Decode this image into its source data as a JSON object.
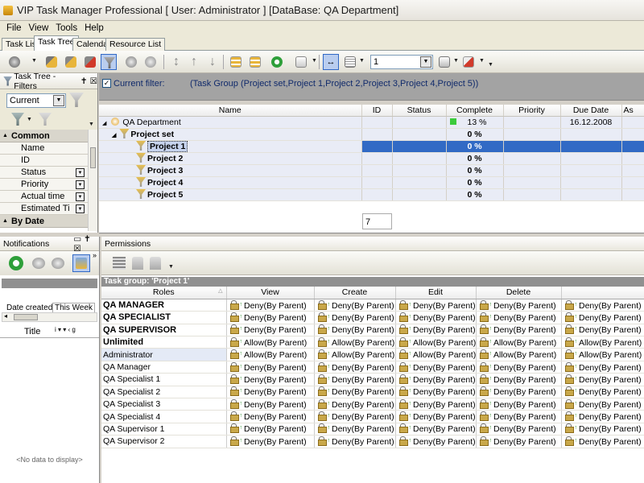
{
  "window": {
    "title": "VIP Task Manager Professional [ User: Administrator ] [DataBase: QA Department]"
  },
  "menu": [
    "File",
    "View",
    "Tools",
    "Help"
  ],
  "tabs": [
    "Task List",
    "Task Tree",
    "Calendar",
    "Resource List"
  ],
  "toolbar": {
    "page_value": "1"
  },
  "filters_panel": {
    "title": "Task Tree - Filters",
    "current": "Current",
    "common_label": "Common",
    "fields": [
      "Name",
      "ID",
      "Status",
      "Priority",
      "Actual time",
      "Estimated Ti"
    ],
    "by_date_label": "By Date"
  },
  "filter_bar": {
    "checkbox_label": "Current filter:",
    "expression": "(Task Group  (Project set,Project 1,Project 2,Project 3,Project 4,Project 5))"
  },
  "tree": {
    "columns": [
      "Name",
      "ID",
      "Status",
      "Complete",
      "Priority",
      "Due Date",
      "As"
    ],
    "rows": [
      {
        "name": "QA Department",
        "complete": "13 %",
        "due": "16.12.2008"
      },
      {
        "name": "Project set",
        "complete": "0 %"
      },
      {
        "name": "Project 1",
        "complete": "0 %"
      },
      {
        "name": "Project 2",
        "complete": "0 %"
      },
      {
        "name": "Project 3",
        "complete": "0 %"
      },
      {
        "name": "Project 4",
        "complete": "0 %"
      },
      {
        "name": "Project 5",
        "complete": "0 %"
      }
    ],
    "count": "7"
  },
  "notifications": {
    "title": "Notifications",
    "date_created": "Date created",
    "period": "This Week",
    "title_col": "Title",
    "empty": "<No data to display>"
  },
  "permissions": {
    "title": "Permissions",
    "group": "Task group: 'Project 1'",
    "columns": [
      "Roles",
      "View",
      "Create",
      "Edit",
      "Delete"
    ],
    "rows": [
      {
        "role": "QA MANAGER",
        "bold": true,
        "v": "Deny(By Parent)"
      },
      {
        "role": "QA SPECIALIST",
        "bold": true,
        "v": "Deny(By Parent)"
      },
      {
        "role": "QA SUPERVISOR",
        "bold": true,
        "v": "Deny(By Parent)"
      },
      {
        "role": "Unlimited",
        "bold": true,
        "v": "Allow(By Parent)"
      },
      {
        "role": "Administrator",
        "bold": false,
        "v": "Allow(By Parent)"
      },
      {
        "role": "QA Manager",
        "bold": false,
        "v": "Deny(By Parent)"
      },
      {
        "role": "QA Specialist 1",
        "bold": false,
        "v": "Deny(By Parent)"
      },
      {
        "role": "QA Specialist 2",
        "bold": false,
        "v": "Deny(By Parent)"
      },
      {
        "role": "QA Specialist 3",
        "bold": false,
        "v": "Deny(By Parent)"
      },
      {
        "role": "QA Specialist 4",
        "bold": false,
        "v": "Deny(By Parent)"
      },
      {
        "role": "QA Supervisor 1",
        "bold": false,
        "v": "Deny(By Parent)"
      },
      {
        "role": "QA Supervisor 2",
        "bold": false,
        "v": "Deny(By Parent)"
      }
    ]
  }
}
